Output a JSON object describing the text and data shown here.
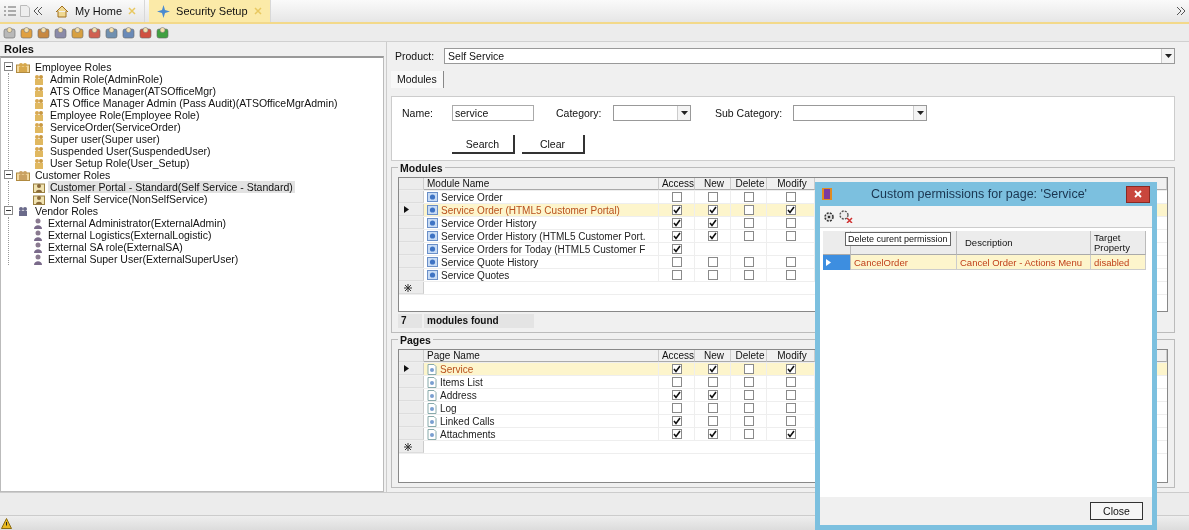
{
  "tab_bar": {
    "tabs": [
      {
        "label": "My Home",
        "selected": false
      },
      {
        "label": "Security Setup",
        "selected": true
      }
    ]
  },
  "roles_panel": {
    "title": "Roles",
    "tree": [
      {
        "label": "Employee Roles",
        "kind": "employee",
        "expanded": true,
        "selected": false,
        "children": [
          {
            "label": "Admin Role(AdminRole)",
            "selected": false
          },
          {
            "label": "ATS Office Manager(ATSOfficeMgr)",
            "selected": false
          },
          {
            "label": "ATS Office Manager Admin (Pass Audit)(ATSOfficeMgrAdmin)",
            "selected": false
          },
          {
            "label": "Employee Role(Employee Role)",
            "selected": false
          },
          {
            "label": "ServiceOrder(ServiceOrder)",
            "selected": false
          },
          {
            "label": "Super user(Super user)",
            "selected": false
          },
          {
            "label": "Suspended User(SuspendedUser)",
            "selected": false
          },
          {
            "label": "User Setup Role(User_Setup)",
            "selected": false
          }
        ]
      },
      {
        "label": "Customer Roles",
        "kind": "customer",
        "expanded": true,
        "selected": false,
        "children": [
          {
            "label": "Customer Portal - Standard(Self Service - Standard)",
            "selected": true
          },
          {
            "label": "Non Self Service(NonSelfService)",
            "selected": false
          }
        ]
      },
      {
        "label": "Vendor Roles",
        "kind": "vendor",
        "expanded": true,
        "selected": false,
        "children": [
          {
            "label": "External Administrator(ExternalAdmin)",
            "selected": false
          },
          {
            "label": "External Logistics(ExternalLogistic)",
            "selected": false
          },
          {
            "label": "External SA role(ExternalSA)",
            "selected": false
          },
          {
            "label": "External Super User(ExternalSuperUser)",
            "selected": false
          }
        ]
      }
    ]
  },
  "product": {
    "label": "Product:",
    "value": "Self Service"
  },
  "tabs": [
    {
      "label": "Modules",
      "selected": true
    }
  ],
  "search": {
    "name_label": "Name:",
    "name_value": "service",
    "category_label": "Category:",
    "sub_category_label": "Sub Category:",
    "buttons": [
      "Search",
      "Clear"
    ]
  },
  "modules_grid": {
    "title": "Modules",
    "columns": [
      "Module Name",
      "Access",
      "New",
      "Delete",
      "Modify"
    ],
    "rows": [
      {
        "name": "Service Order",
        "selected": false,
        "checks": [
          false,
          false,
          false,
          false
        ]
      },
      {
        "name": "Service Order (HTML5 Customer Portal)",
        "selected": true,
        "checks": [
          true,
          true,
          false,
          true
        ]
      },
      {
        "name": "Service Order History",
        "selected": false,
        "checks": [
          true,
          true,
          false,
          false
        ]
      },
      {
        "name": "Service Order History (HTML5 Customer Port.",
        "selected": false,
        "checks": [
          true,
          true,
          false,
          false
        ]
      },
      {
        "name": "Service Orders for Today (HTML5 Customer F",
        "selected": false,
        "checks": [
          true
        ]
      },
      {
        "name": "Service Quote History",
        "selected": false,
        "checks": [
          false,
          false,
          false,
          false
        ]
      },
      {
        "name": "Service Quotes",
        "selected": false,
        "checks": [
          false,
          false,
          false,
          false
        ]
      }
    ],
    "count": "7",
    "count_label": "modules found"
  },
  "pages_grid": {
    "title": "Pages",
    "columns": [
      "Page Name",
      "Access",
      "New",
      "Delete",
      "Modify"
    ],
    "rows": [
      {
        "name": "Service",
        "selected": true,
        "checks": [
          true,
          true,
          false,
          true
        ]
      },
      {
        "name": "Items List",
        "selected": false,
        "checks": [
          false,
          false,
          false,
          false
        ]
      },
      {
        "name": "Address",
        "selected": false,
        "checks": [
          true,
          true,
          false,
          false
        ]
      },
      {
        "name": "Log",
        "selected": false,
        "checks": [
          false,
          false,
          false,
          false
        ]
      },
      {
        "name": "Linked Calls",
        "selected": false,
        "checks": [
          true,
          false,
          false,
          false
        ]
      },
      {
        "name": "Attachments",
        "selected": false,
        "checks": [
          true,
          true,
          false,
          true
        ]
      }
    ]
  },
  "dialog": {
    "title": "Custom permissions for page: 'Service'",
    "tooltip": "Delete curent permission",
    "columns": [
      "Description",
      "Target Property"
    ],
    "rows": [
      {
        "name": "CancelOrder",
        "description": "Cancel Order - Actions Menu",
        "target_property": "disabled",
        "selected": true
      }
    ],
    "close_button": "Close"
  }
}
